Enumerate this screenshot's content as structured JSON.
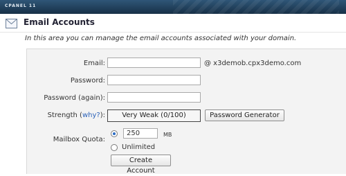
{
  "topbar": {
    "brand": "CPANEL 11"
  },
  "header": {
    "title": "Email Accounts",
    "icon": "mail-icon"
  },
  "description": "In this area you can manage the email accounts associated with your domain.",
  "form": {
    "email_label": "Email:",
    "email_value": "",
    "domain_suffix": "@ x3demob.cpx3demo.com",
    "password_label": "Password:",
    "password_value": "",
    "password_again_label": "Password (again):",
    "password_again_value": "",
    "strength_label": "Strength (",
    "strength_link": "why?",
    "strength_label_end": "):",
    "strength_value": "Very Weak (0/100)",
    "password_generator_button": "Password Generator",
    "mailbox_quota_label": "Mailbox Quota:",
    "quota_value": "250",
    "quota_unit": "MB",
    "unlimited_label": "Unlimited",
    "quota_selected": "limited",
    "create_button": "Create Account"
  }
}
